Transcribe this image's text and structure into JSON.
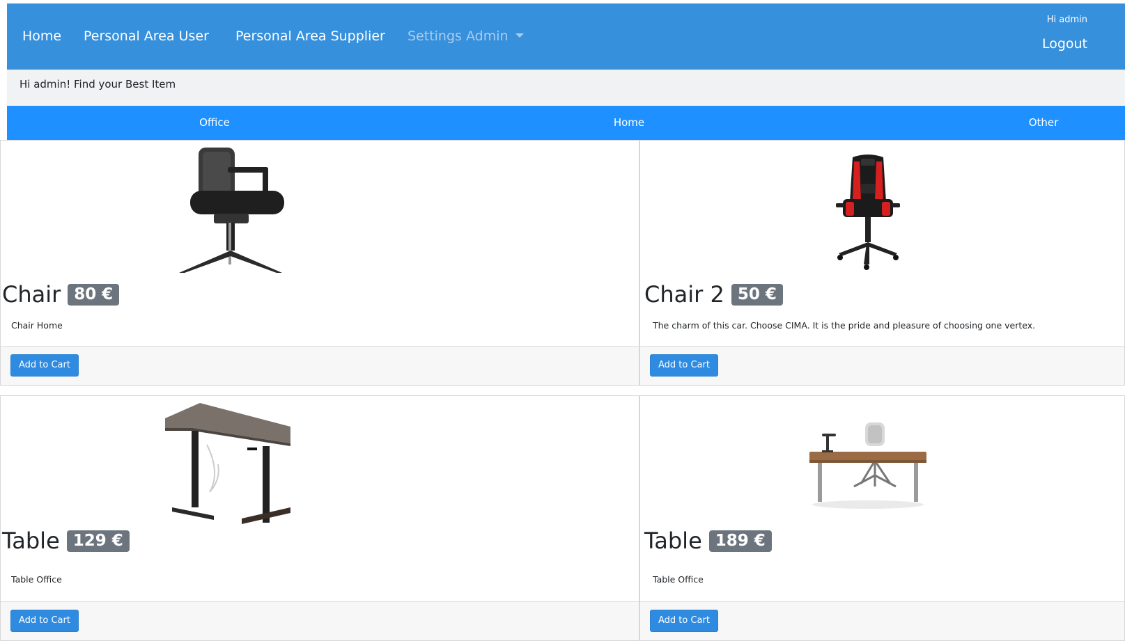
{
  "nav": {
    "home": "Home",
    "personal_area_user": "Personal Area User",
    "personal_area_supplier": "Personal Area Supplier",
    "settings_admin": "Settings Admin",
    "greeting": "Hi admin",
    "logout": "Logout"
  },
  "welcome": "Hi admin! Find your Best Item",
  "categories": [
    "Office",
    "Home",
    "Other"
  ],
  "cart_button_label": "Add to Cart",
  "items": [
    {
      "name": "Chair",
      "price": "80 €",
      "description": "Chair Home",
      "image": "office-chair-image"
    },
    {
      "name": "Chair 2",
      "price": "50 €",
      "description": "The charm of this car. Choose CIMA. It is the pride and pleasure of choosing one vertex.",
      "image": "gaming-chair-image"
    },
    {
      "name": "Table",
      "price": "129 €",
      "description": "Table Office",
      "image": "standing-desk-image"
    },
    {
      "name": "Table",
      "price": "189 €",
      "description": "Table Office",
      "image": "office-desk-image"
    }
  ],
  "colors": {
    "navbar": "#3790dc",
    "category_bar": "#1e90ff",
    "button": "#2f8be0",
    "badge": "#6c757d"
  }
}
